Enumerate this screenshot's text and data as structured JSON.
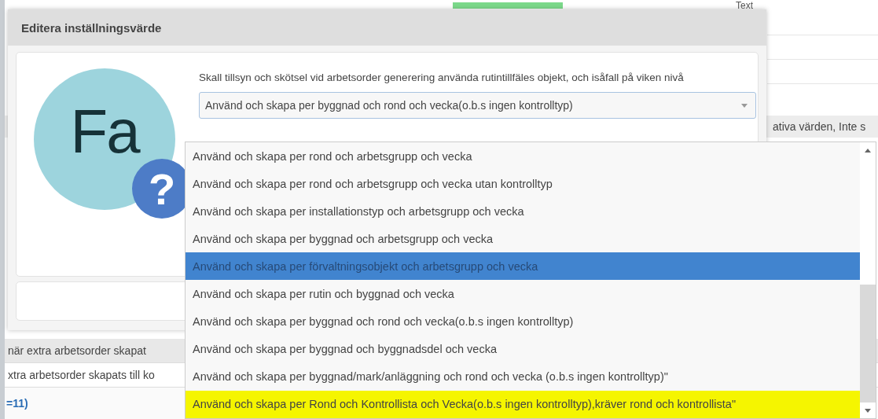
{
  "background": {
    "header_text": "Text",
    "side_text": "ativa värden, Inte s",
    "rows": [
      "när extra arbetsorder skapat",
      "xtra arbetsorder skapats till ko"
    ],
    "link": "=11)"
  },
  "dialog": {
    "title": "Editera inställningsvärde",
    "logo": {
      "letters": "Fa",
      "badge": "?"
    },
    "question": "Skall tillsyn och skötsel vid arbetsorder generering använda rutintillfäles objekt, och isåfall på viken nivå",
    "select": {
      "value": "Använd och skapa per byggnad och rond och vecka(o.b.s ingen kontrolltyp)",
      "expanded": true
    }
  },
  "dropdown": {
    "options": [
      {
        "label": "Använd och skapa per rond och arbetsgrupp och vecka",
        "selected": false,
        "highlighted": false
      },
      {
        "label": "Använd och skapa per rond och arbetsgrupp och vecka utan kontrolltyp",
        "selected": false,
        "highlighted": false
      },
      {
        "label": "Använd och skapa per installationstyp och arbetsgrupp och vecka",
        "selected": false,
        "highlighted": false
      },
      {
        "label": "Använd och skapa per byggnad och arbetsgrupp och vecka",
        "selected": false,
        "highlighted": false
      },
      {
        "label": "Använd och skapa per förvaltningsobjekt och arbetsgrupp och vecka",
        "selected": true,
        "highlighted": false
      },
      {
        "label": "Använd och skapa per rutin och byggnad och vecka",
        "selected": false,
        "highlighted": false
      },
      {
        "label": "Använd och skapa per byggnad och rond och vecka(o.b.s ingen kontrolltyp)",
        "selected": false,
        "highlighted": false
      },
      {
        "label": "Använd och skapa per byggnad och byggnadsdel och vecka",
        "selected": false,
        "highlighted": false
      },
      {
        "label": "Använd och skapa per byggnad/mark/anläggning och rond och vecka (o.b.s ingen kontrolltyp)\"",
        "selected": false,
        "highlighted": false
      },
      {
        "label": "Använd och skapa per Rond och Kontrollista och Vecka(o.b.s ingen kontrolltyp),kräver rond och kontrollista\"",
        "selected": false,
        "highlighted": true
      }
    ]
  }
}
